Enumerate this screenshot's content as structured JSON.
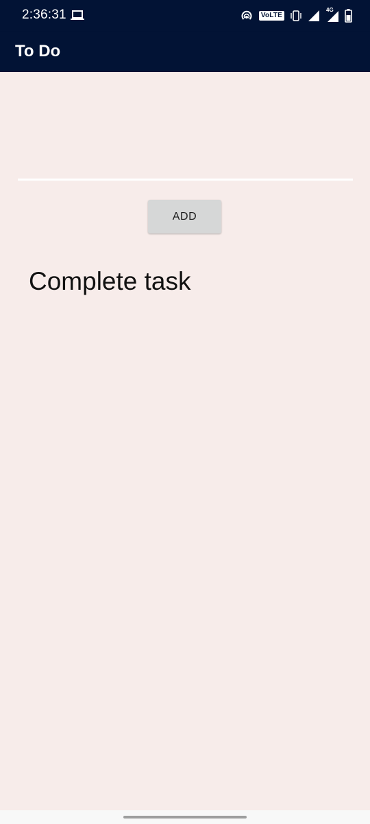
{
  "status_bar": {
    "time": "2:36:31",
    "volte_label": "VoLTE",
    "network_type": "4G",
    "icons": [
      "laptop-icon",
      "hotspot-icon",
      "volte-icon",
      "vibrate-icon",
      "signal-icon",
      "network-4g-icon",
      "battery-icon"
    ]
  },
  "app_bar": {
    "title": "To Do",
    "background_color": "#021335"
  },
  "task_input": {
    "value": "",
    "placeholder": ""
  },
  "add_button": {
    "label": "ADD"
  },
  "tasks": [
    {
      "label": "Complete task"
    }
  ],
  "colors": {
    "content_background": "#f7ecea",
    "button_background": "#d6d7d7"
  }
}
